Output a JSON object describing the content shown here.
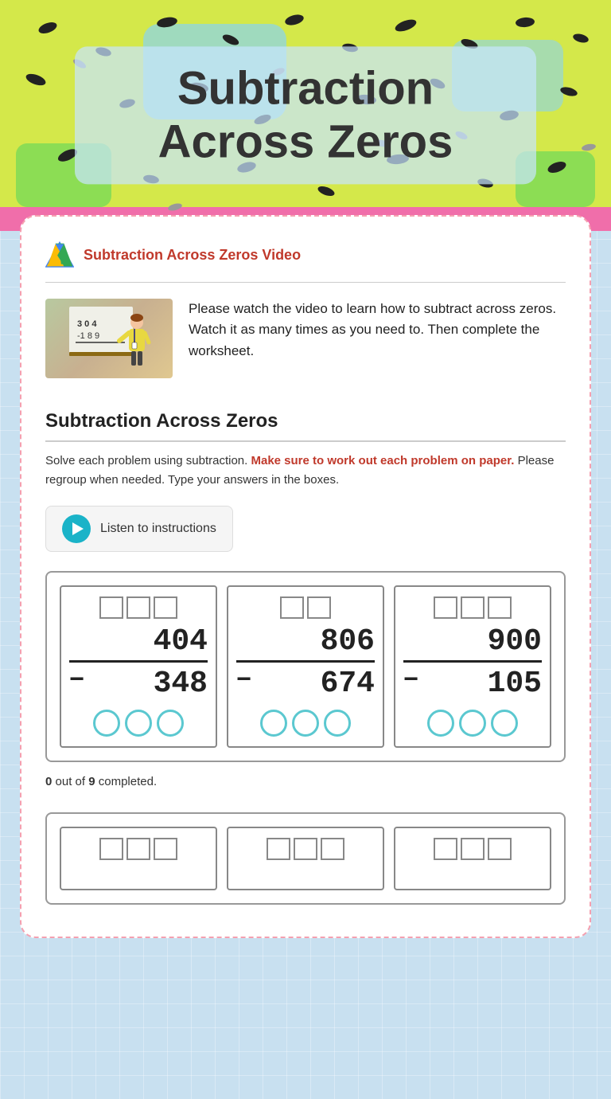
{
  "page": {
    "title": "Subtraction Across Zeros",
    "hero_bg_colors": [
      "#d4e84a",
      "#f5a0b0",
      "#89d4f0",
      "#f5f590"
    ],
    "accent_color": "#1ab3c8"
  },
  "drive_link": {
    "label": "Subtraction Across Zeros Video",
    "icon": "google-drive"
  },
  "video_section": {
    "description": "Please watch the video to learn how to subtract across zeros. Watch it as many times as you need to. Then complete the worksheet."
  },
  "worksheet": {
    "title": "Subtraction Across Zeros",
    "instruction_plain": "Solve each problem using subtraction.",
    "instruction_highlight": "Make sure to work out each problem on paper.",
    "instruction_plain2": "Please regroup when needed. Type your answers in the boxes.",
    "listen_button": "Listen to instructions"
  },
  "problems": [
    {
      "top": "404",
      "bottom": "348"
    },
    {
      "top": "806",
      "bottom": "674"
    },
    {
      "top": "900",
      "bottom": "105"
    }
  ],
  "progress": {
    "completed": "0",
    "total": "9",
    "label": "completed."
  }
}
